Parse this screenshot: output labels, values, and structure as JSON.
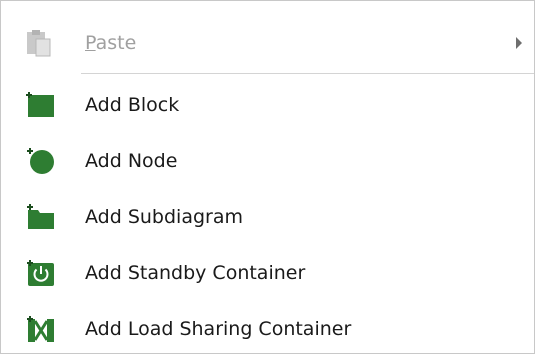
{
  "menu": {
    "paste": {
      "label_prefix": "P",
      "label_rest": "aste",
      "icon": "clipboard-icon",
      "enabled": false,
      "has_submenu": true
    },
    "items": [
      {
        "label": "Add Block",
        "icon": "block-icon"
      },
      {
        "label": "Add Node",
        "icon": "node-icon"
      },
      {
        "label": "Add Subdiagram",
        "icon": "subdiagram-icon"
      },
      {
        "label": "Add Standby Container",
        "icon": "standby-container-icon"
      },
      {
        "label": "Add Load Sharing Container",
        "icon": "load-sharing-container-icon"
      }
    ]
  },
  "colors": {
    "icon_green": "#2e7d32",
    "icon_dark": "#1b4d1e",
    "disabled_text": "#a0a0a0",
    "separator": "#d4d4d4"
  }
}
